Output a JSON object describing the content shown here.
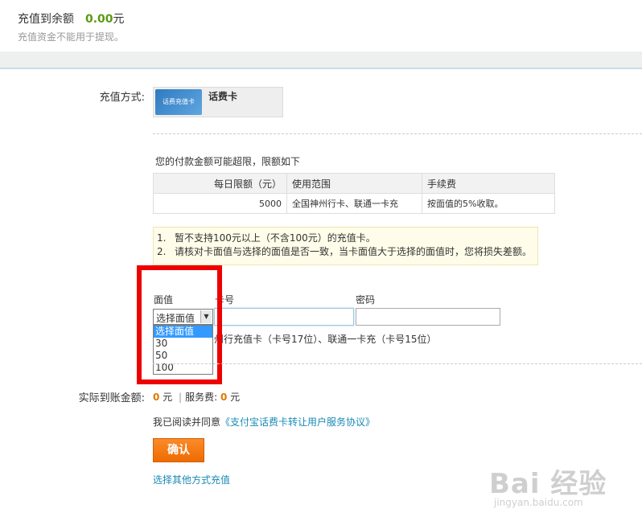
{
  "header": {
    "title": "充值到余额",
    "amount": "0.00",
    "unit": "元",
    "subtitle": "充值资金不能用于提现。"
  },
  "method": {
    "label": "充值方式:",
    "card_image_text": "话费充值卡",
    "card_name": "话费卡"
  },
  "limits": {
    "title": "您的付款金额可能超限，限额如下",
    "headers": [
      "每日限额（元）",
      "使用范围",
      "手续费"
    ],
    "row": [
      "5000",
      "全国神州行卡、联通一卡充",
      "按面值的5%收取。"
    ]
  },
  "notice": {
    "items": [
      {
        "n": "1.",
        "text": "暂不支持100元以上（不含100元）的充值卡。"
      },
      {
        "n": "2.",
        "text": "请核对卡面值与选择的面值是否一致，当卡面值大于选择的面值时，您将损失差额。"
      }
    ]
  },
  "form": {
    "face_label": "面值",
    "card_label": "卡号",
    "pwd_label": "密码",
    "select_value": "选择面值",
    "options": [
      "选择面值",
      "30",
      "50",
      "100"
    ],
    "card_hint": "州行充值卡（卡号17位）、联通一卡充（卡号15位）"
  },
  "actual": {
    "label": "实际到账金额:",
    "amount": "0",
    "unit1": "元",
    "sep": "|",
    "fee_label": "服务费:",
    "fee": "0",
    "unit2": "元"
  },
  "agree": {
    "prefix": "我已阅读并同意",
    "link": "《支付宝话费卡转让用户服务协议》"
  },
  "confirm_label": "确认",
  "other_link": "选择其他方式充值",
  "watermark": {
    "main": "Bai 经验",
    "sub": "jingyan.baidu.com"
  },
  "colors": {
    "amount_green": "#5a9a12",
    "orange": "#ee6b00",
    "link_blue": "#1a8ab5",
    "highlight_red": "#ee0000"
  }
}
